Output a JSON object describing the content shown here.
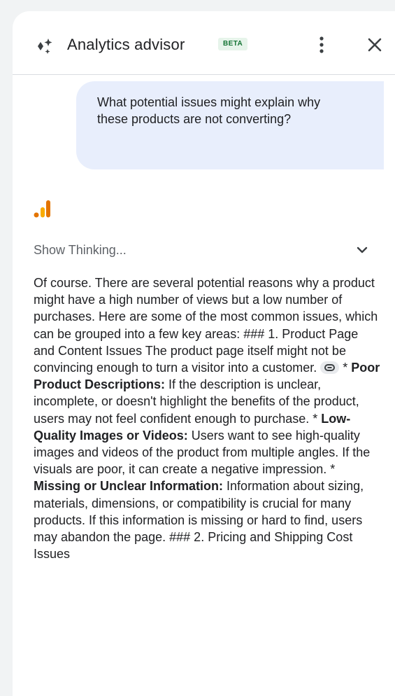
{
  "header": {
    "title": "Analytics advisor",
    "badge": "BETA",
    "icons": [
      "sparkle-icon",
      "more-vert-icon",
      "close-icon"
    ]
  },
  "conversation": {
    "user_message": "What potential issues might explain why these products are not converting?",
    "assistant_icon": "google-analytics-logo",
    "thinking_label": "Show Thinking...",
    "answer": {
      "intro": "Of course. There are several potential reasons why a product might have a high number of views but a low number of purchases. Here are some of the most common issues, which can be grouped into a few key areas: ### 1. Product Page and Content Issues The product page itself might not be convincing enough to turn a visitor into a customer.",
      "items": [
        {
          "prefix": "* ",
          "title": "Poor Product Descriptions:",
          "text": "If the description is unclear, incomplete, or doesn't highlight the benefits of the product, users may not feel confident enough to purchase."
        },
        {
          "prefix": "* ",
          "title": "Low-Quality Images or Videos:",
          "text": "Users want to see high-quality images and videos of the product from multiple angles. If the visuals are poor, it can create a negative impression."
        },
        {
          "prefix": "* ",
          "title": "Missing or Unclear Information:",
          "text": "Information about sizing, materials, dimensions, or compatibility is crucial for many products. If this information is missing or hard to find, users may abandon the page. ### 2. Pricing and Shipping Cost Issues"
        }
      ]
    }
  },
  "colors": {
    "badge_bg": "#e6f4ea",
    "badge_text": "#137333",
    "user_bubble": "#e8eefc",
    "ga_orange": "#f9ab00",
    "ga_dark_orange": "#e37400"
  }
}
